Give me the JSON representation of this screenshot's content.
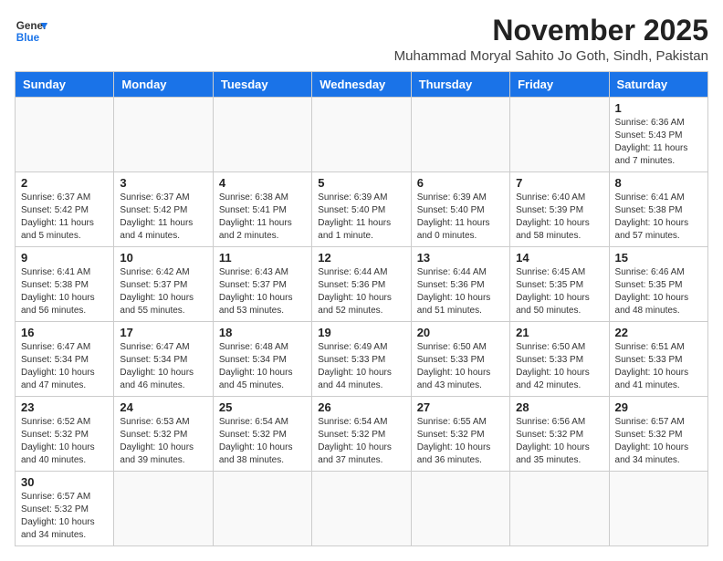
{
  "header": {
    "logo_general": "General",
    "logo_blue": "Blue",
    "month_title": "November 2025",
    "subtitle": "Muhammad Moryal Sahito Jo Goth, Sindh, Pakistan"
  },
  "weekdays": [
    "Sunday",
    "Monday",
    "Tuesday",
    "Wednesday",
    "Thursday",
    "Friday",
    "Saturday"
  ],
  "weeks": [
    [
      {
        "day": "",
        "info": ""
      },
      {
        "day": "",
        "info": ""
      },
      {
        "day": "",
        "info": ""
      },
      {
        "day": "",
        "info": ""
      },
      {
        "day": "",
        "info": ""
      },
      {
        "day": "",
        "info": ""
      },
      {
        "day": "1",
        "info": "Sunrise: 6:36 AM\nSunset: 5:43 PM\nDaylight: 11 hours and 7 minutes."
      }
    ],
    [
      {
        "day": "2",
        "info": "Sunrise: 6:37 AM\nSunset: 5:42 PM\nDaylight: 11 hours and 5 minutes."
      },
      {
        "day": "3",
        "info": "Sunrise: 6:37 AM\nSunset: 5:42 PM\nDaylight: 11 hours and 4 minutes."
      },
      {
        "day": "4",
        "info": "Sunrise: 6:38 AM\nSunset: 5:41 PM\nDaylight: 11 hours and 2 minutes."
      },
      {
        "day": "5",
        "info": "Sunrise: 6:39 AM\nSunset: 5:40 PM\nDaylight: 11 hours and 1 minute."
      },
      {
        "day": "6",
        "info": "Sunrise: 6:39 AM\nSunset: 5:40 PM\nDaylight: 11 hours and 0 minutes."
      },
      {
        "day": "7",
        "info": "Sunrise: 6:40 AM\nSunset: 5:39 PM\nDaylight: 10 hours and 58 minutes."
      },
      {
        "day": "8",
        "info": "Sunrise: 6:41 AM\nSunset: 5:38 PM\nDaylight: 10 hours and 57 minutes."
      }
    ],
    [
      {
        "day": "9",
        "info": "Sunrise: 6:41 AM\nSunset: 5:38 PM\nDaylight: 10 hours and 56 minutes."
      },
      {
        "day": "10",
        "info": "Sunrise: 6:42 AM\nSunset: 5:37 PM\nDaylight: 10 hours and 55 minutes."
      },
      {
        "day": "11",
        "info": "Sunrise: 6:43 AM\nSunset: 5:37 PM\nDaylight: 10 hours and 53 minutes."
      },
      {
        "day": "12",
        "info": "Sunrise: 6:44 AM\nSunset: 5:36 PM\nDaylight: 10 hours and 52 minutes."
      },
      {
        "day": "13",
        "info": "Sunrise: 6:44 AM\nSunset: 5:36 PM\nDaylight: 10 hours and 51 minutes."
      },
      {
        "day": "14",
        "info": "Sunrise: 6:45 AM\nSunset: 5:35 PM\nDaylight: 10 hours and 50 minutes."
      },
      {
        "day": "15",
        "info": "Sunrise: 6:46 AM\nSunset: 5:35 PM\nDaylight: 10 hours and 48 minutes."
      }
    ],
    [
      {
        "day": "16",
        "info": "Sunrise: 6:47 AM\nSunset: 5:34 PM\nDaylight: 10 hours and 47 minutes."
      },
      {
        "day": "17",
        "info": "Sunrise: 6:47 AM\nSunset: 5:34 PM\nDaylight: 10 hours and 46 minutes."
      },
      {
        "day": "18",
        "info": "Sunrise: 6:48 AM\nSunset: 5:34 PM\nDaylight: 10 hours and 45 minutes."
      },
      {
        "day": "19",
        "info": "Sunrise: 6:49 AM\nSunset: 5:33 PM\nDaylight: 10 hours and 44 minutes."
      },
      {
        "day": "20",
        "info": "Sunrise: 6:50 AM\nSunset: 5:33 PM\nDaylight: 10 hours and 43 minutes."
      },
      {
        "day": "21",
        "info": "Sunrise: 6:50 AM\nSunset: 5:33 PM\nDaylight: 10 hours and 42 minutes."
      },
      {
        "day": "22",
        "info": "Sunrise: 6:51 AM\nSunset: 5:33 PM\nDaylight: 10 hours and 41 minutes."
      }
    ],
    [
      {
        "day": "23",
        "info": "Sunrise: 6:52 AM\nSunset: 5:32 PM\nDaylight: 10 hours and 40 minutes."
      },
      {
        "day": "24",
        "info": "Sunrise: 6:53 AM\nSunset: 5:32 PM\nDaylight: 10 hours and 39 minutes."
      },
      {
        "day": "25",
        "info": "Sunrise: 6:54 AM\nSunset: 5:32 PM\nDaylight: 10 hours and 38 minutes."
      },
      {
        "day": "26",
        "info": "Sunrise: 6:54 AM\nSunset: 5:32 PM\nDaylight: 10 hours and 37 minutes."
      },
      {
        "day": "27",
        "info": "Sunrise: 6:55 AM\nSunset: 5:32 PM\nDaylight: 10 hours and 36 minutes."
      },
      {
        "day": "28",
        "info": "Sunrise: 6:56 AM\nSunset: 5:32 PM\nDaylight: 10 hours and 35 minutes."
      },
      {
        "day": "29",
        "info": "Sunrise: 6:57 AM\nSunset: 5:32 PM\nDaylight: 10 hours and 34 minutes."
      }
    ],
    [
      {
        "day": "30",
        "info": "Sunrise: 6:57 AM\nSunset: 5:32 PM\nDaylight: 10 hours and 34 minutes."
      },
      {
        "day": "",
        "info": ""
      },
      {
        "day": "",
        "info": ""
      },
      {
        "day": "",
        "info": ""
      },
      {
        "day": "",
        "info": ""
      },
      {
        "day": "",
        "info": ""
      },
      {
        "day": "",
        "info": ""
      }
    ]
  ]
}
